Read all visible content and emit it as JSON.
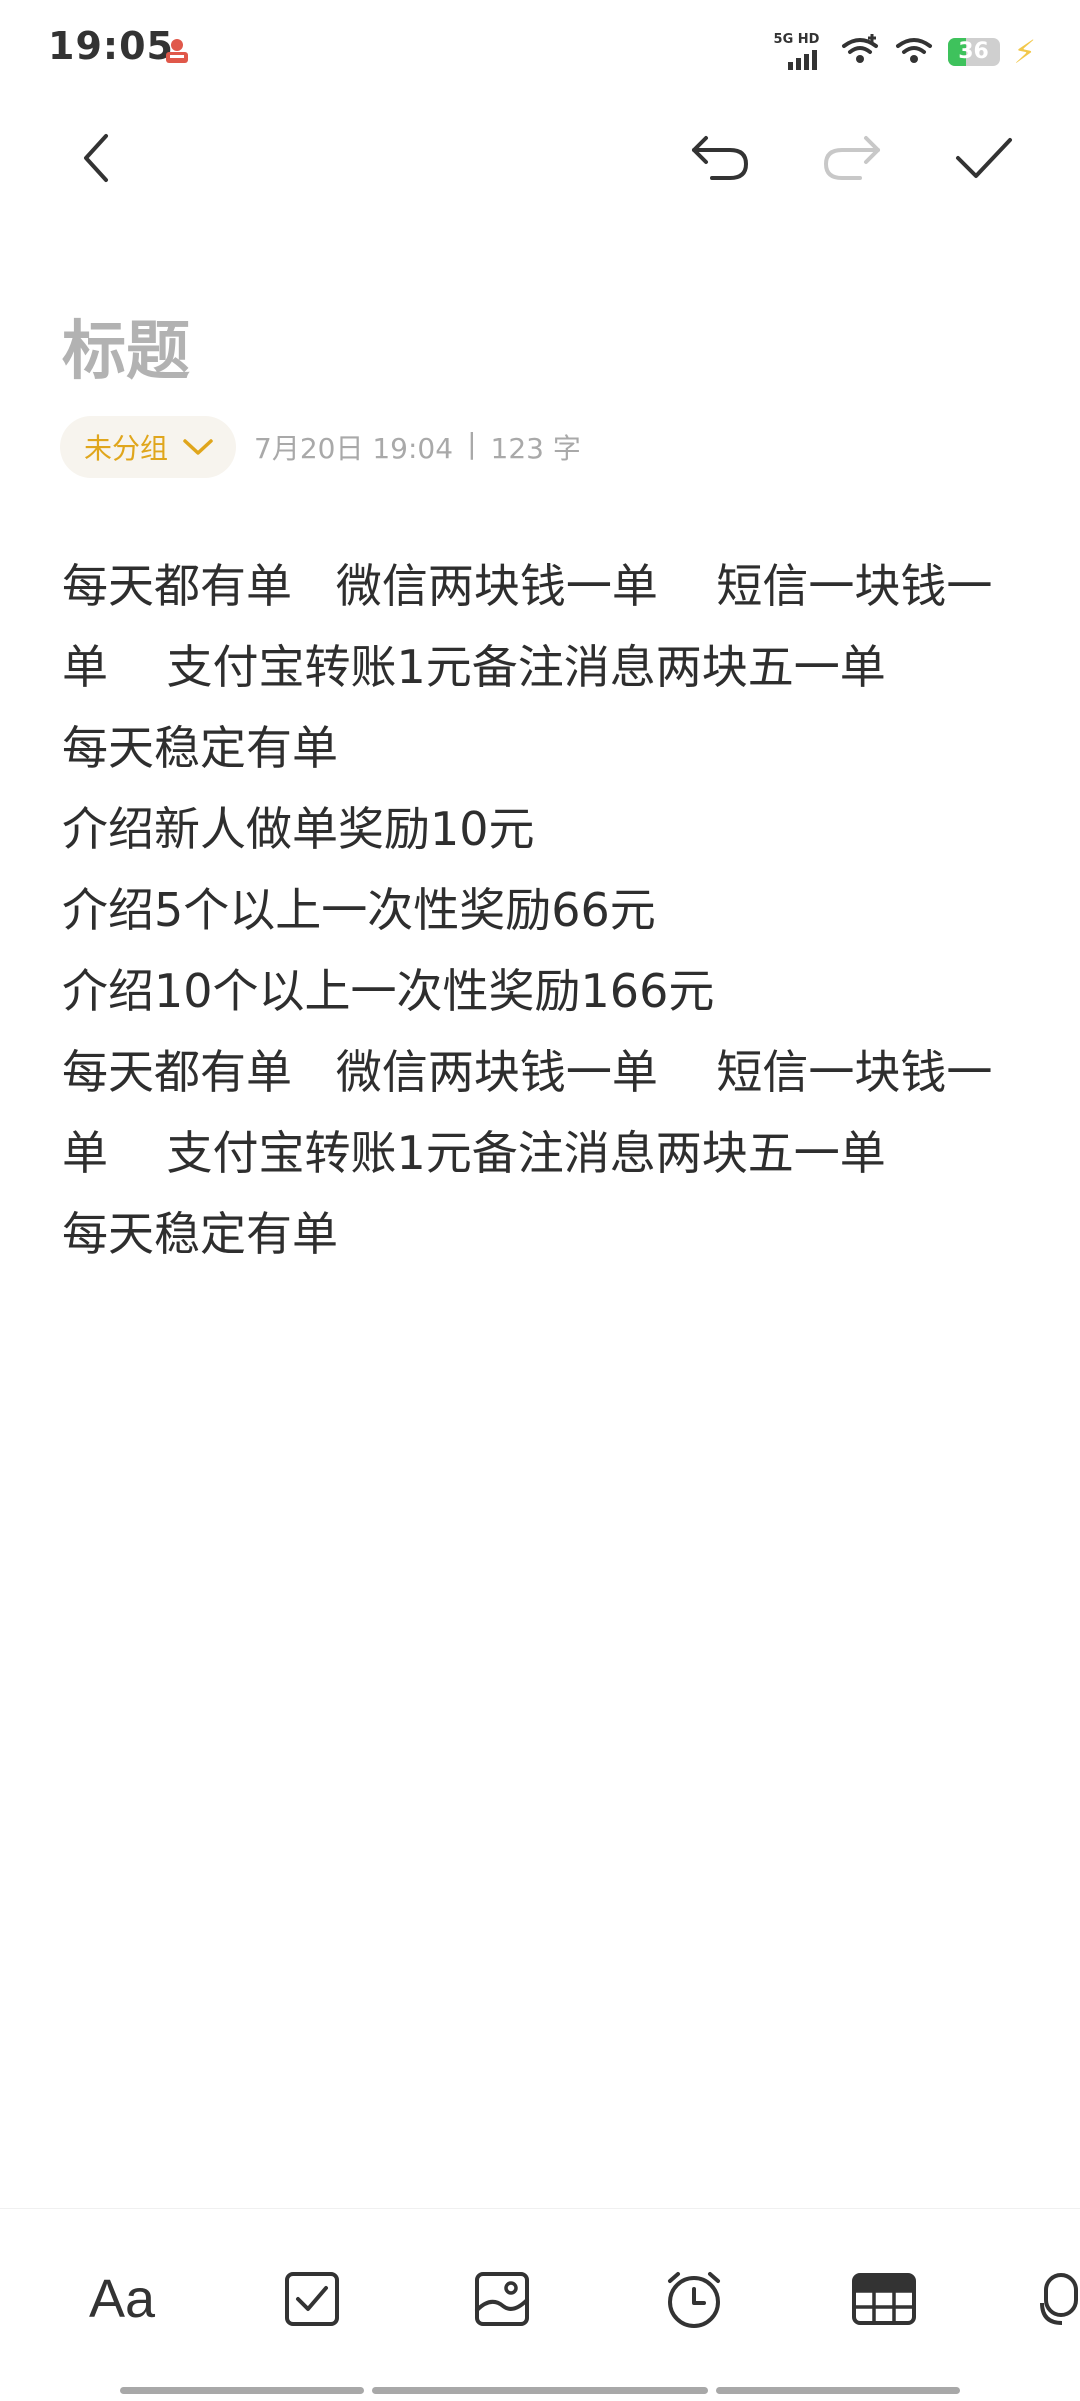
{
  "status_bar": {
    "time": "19:05",
    "network_label": "5G HD",
    "battery": "36",
    "battery_level": 0.36,
    "icons": [
      "app-notification-icon",
      "cellular-signal-icon",
      "wifi-plus-icon",
      "wifi-icon",
      "battery-icon",
      "charging-bolt-icon"
    ]
  },
  "toolbar": {
    "icons": [
      "back-icon",
      "undo-icon",
      "redo-icon",
      "done-check-icon"
    ]
  },
  "note": {
    "title_placeholder": "标题",
    "group_label": "未分组",
    "date": "7月20日 19:04",
    "separator": "|",
    "word_count": "123 字",
    "lines": [
      "每天都有单   微信两块钱一单    短信一块钱一",
      "单    支付宝转账1元备注消息两块五一单",
      "每天稳定有单",
      "介绍新人做单奖励10元",
      "介绍5个以上一次性奖励66元",
      "介绍10个以上一次性奖励166元",
      "每天都有单   微信两块钱一单    短信一块钱一",
      "单    支付宝转账1元备注消息两块五一单",
      "每天稳定有单"
    ]
  },
  "bottom_toolbar": {
    "text_style_label": "Aa",
    "icons": [
      "text-style-icon",
      "checklist-icon",
      "image-icon",
      "reminder-clock-icon",
      "table-icon",
      "voice-icon"
    ]
  },
  "colors": {
    "accent": "#e0a61c",
    "chip_bg": "#f7f4ee",
    "body_text": "#2e2e2e",
    "muted": "#a9a9a9",
    "battery_green": "#3ec25c"
  }
}
